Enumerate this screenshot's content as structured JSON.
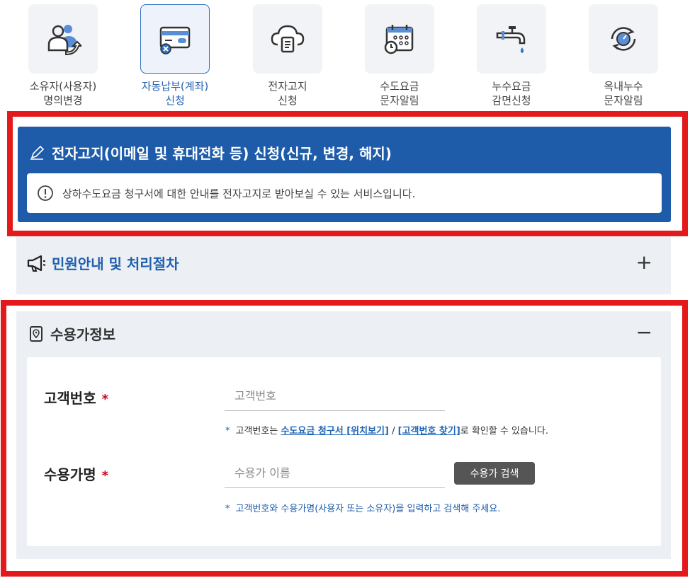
{
  "services": [
    {
      "label": "소유자(사용자)\n명의변경",
      "icon": "owner-change-icon"
    },
    {
      "label": "자동납부(계좌)\n신청",
      "icon": "card-autopay-icon"
    },
    {
      "label": "전자고지\n신청",
      "icon": "cloud-document-icon"
    },
    {
      "label": "수도요금\n문자알림",
      "icon": "calendar-alarm-icon"
    },
    {
      "label": "누수요금\n감면신청",
      "icon": "faucet-drop-icon"
    },
    {
      "label": "옥내누수\n문자알림",
      "icon": "gauge-refresh-icon"
    }
  ],
  "banner": {
    "title": "전자고지(이메일 및 휴대전화 등) 신청(신규, 변경, 해지)",
    "notice": "상하수도요금 청구서에 대한 안내를 전자고지로 받아보실 수 있는 서비스입니다."
  },
  "guide": {
    "title": "민원안내 및 처리절차",
    "toggle": "+"
  },
  "customer_info": {
    "title": "수용가정보",
    "toggle": "−",
    "customer_number": {
      "label": "고객번호",
      "required_mark": "*",
      "placeholder": "고객번호",
      "hint_star": "*",
      "hint_prefix": "고객번호는",
      "hint_link1": "수도요금 청구서 [위치보기]",
      "hint_sep": "/",
      "hint_link2": "[고객번호 찾기]",
      "hint_suffix": "로 확인할 수 있습니다."
    },
    "customer_name": {
      "label": "수용가명",
      "required_mark": "*",
      "placeholder": "수용가 이름",
      "search_button": "수용가 검색",
      "hint_star": "*",
      "hint": "고객번호와 수용가명(사용자 또는 소유자)을 입력하고 검색해 주세요."
    }
  },
  "colors": {
    "primary": "#1e5caa",
    "highlight": "#e3191b",
    "panel_bg": "#eceff3"
  }
}
